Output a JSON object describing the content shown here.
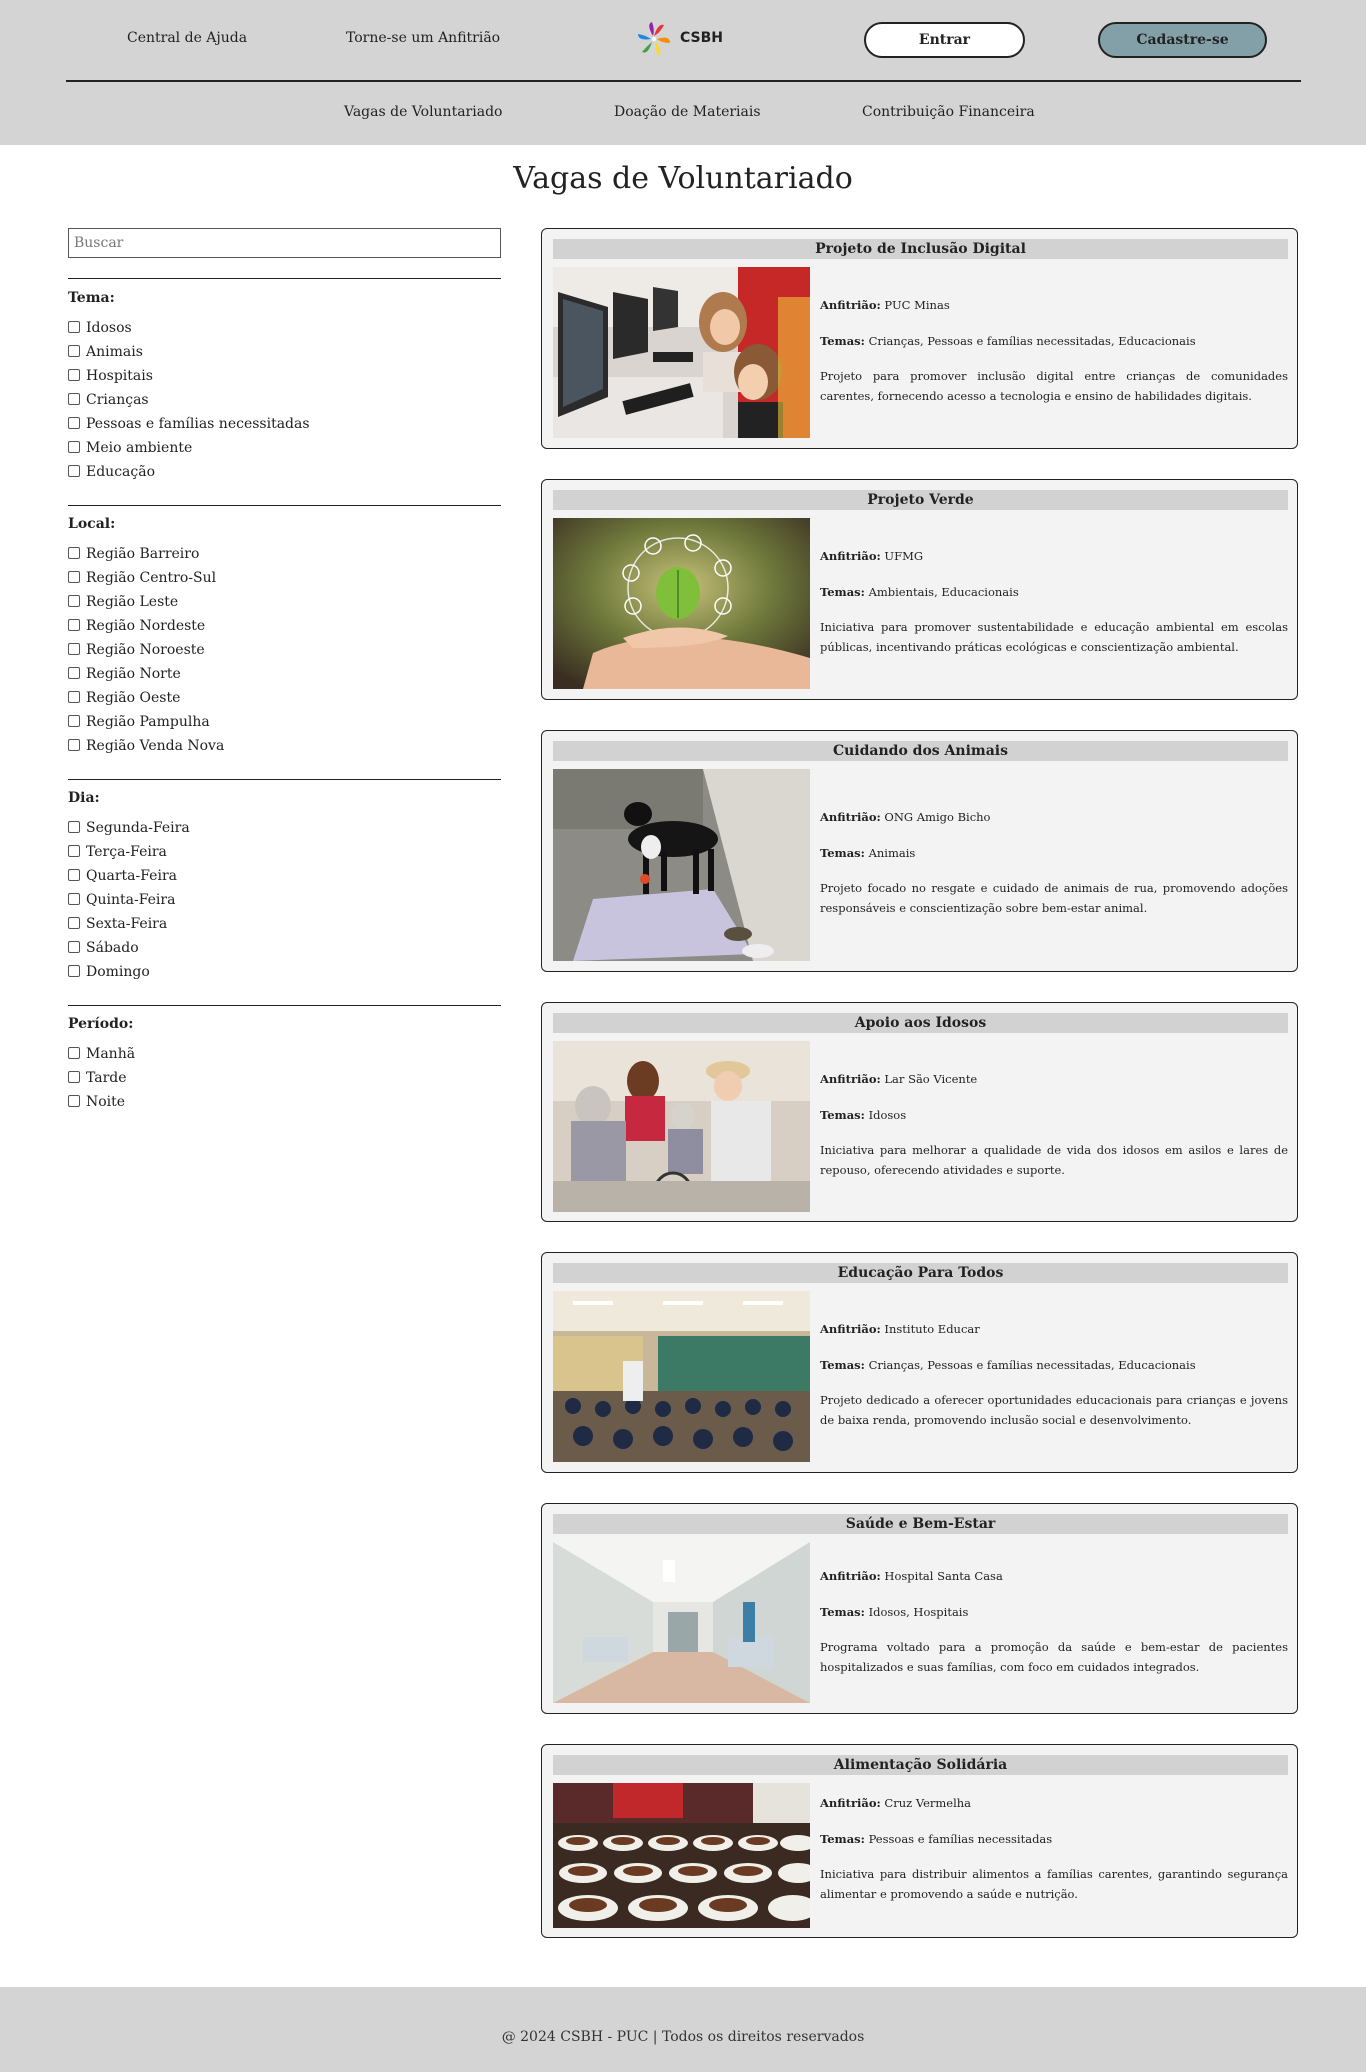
{
  "header": {
    "help_label": "Central de Ajuda",
    "host_label": "Torne-se um Anfitrião",
    "logo_text": "CSBH",
    "login_label": "Entrar",
    "signup_label": "Cadastre-se",
    "nav": [
      "Vagas de Voluntariado",
      "Doação de Materiais",
      "Contribuição Financeira"
    ]
  },
  "page_title": "Vagas de Voluntariado",
  "search": {
    "placeholder": "Buscar",
    "value": ""
  },
  "filters": {
    "tema": {
      "title": "Tema:",
      "options": [
        "Idosos",
        "Animais",
        "Hospitais",
        "Crianças",
        "Pessoas e famílias necessitadas",
        "Meio ambiente",
        "Educação"
      ]
    },
    "local": {
      "title": "Local:",
      "options": [
        "Região Barreiro",
        "Região Centro-Sul",
        "Região Leste",
        "Região Nordeste",
        "Região Noroeste",
        "Região Norte",
        "Região Oeste",
        "Região Pampulha",
        "Região Venda Nova"
      ]
    },
    "dia": {
      "title": "Dia:",
      "options": [
        "Segunda-Feira",
        "Terça-Feira",
        "Quarta-Feira",
        "Quinta-Feira",
        "Sexta-Feira",
        "Sábado",
        "Domingo"
      ]
    },
    "periodo": {
      "title": "Período:",
      "options": [
        "Manhã",
        "Tarde",
        "Noite"
      ]
    }
  },
  "labels": {
    "host": "Anfitrião:",
    "themes": "Temas:"
  },
  "cards": [
    {
      "title": "Projeto de Inclusão Digital",
      "host": "PUC Minas",
      "themes": "Crianças, Pessoas e famílias necessitadas, Educacionais",
      "description": "Projeto para promover inclusão digital entre crianças de comunidades carentes, fornecendo acesso a tecnologia e ensino de habilidades digitais.",
      "image": "children-computers-photo"
    },
    {
      "title": "Projeto Verde",
      "host": "UFMG",
      "themes": "Ambientais, Educacionais",
      "description": "Iniciativa para promover sustentabilidade e educação ambiental em escolas públicas, incentivando práticas ecológicas e conscientização ambiental.",
      "image": "leaf-hand-photo"
    },
    {
      "title": "Cuidando dos Animais",
      "host": "ONG Amigo Bicho",
      "themes": "Animais",
      "description": "Projeto focado no resgate e cuidado de animais de rua, promovendo adoções responsáveis e conscientização sobre bem-estar animal.",
      "image": "street-dog-photo"
    },
    {
      "title": "Apoio aos Idosos",
      "host": "Lar São Vicente",
      "themes": "Idosos",
      "description": "Iniciativa para melhorar a qualidade de vida dos idosos em asilos e lares de repouso, oferecendo atividades e suporte.",
      "image": "elderly-care-photo"
    },
    {
      "title": "Educação Para Todos",
      "host": "Instituto Educar",
      "themes": "Crianças, Pessoas e famílias necessitadas, Educacionais",
      "description": "Projeto dedicado a oferecer oportunidades educacionais para crianças e jovens de baixa renda, promovendo inclusão social e desenvolvimento.",
      "image": "classroom-photo"
    },
    {
      "title": "Saúde e Bem-Estar",
      "host": "Hospital Santa Casa",
      "themes": "Idosos, Hospitais",
      "description": "Programa voltado para a promoção da saúde e bem-estar de pacientes hospitalizados e suas famílias, com foco em cuidados integrados.",
      "image": "hospital-ward-photo"
    },
    {
      "title": "Alimentação Solidária",
      "host": "Cruz Vermelha",
      "themes": "Pessoas e famílias necessitadas",
      "description": "Iniciativa para distribuir alimentos a famílias carentes, garantindo segurança alimentar e promovendo a saúde e nutrição.",
      "image": "food-bowls-photo"
    }
  ],
  "footer": {
    "text": "@ 2024 CSBH - PUC | Todos os direitos reservados"
  }
}
